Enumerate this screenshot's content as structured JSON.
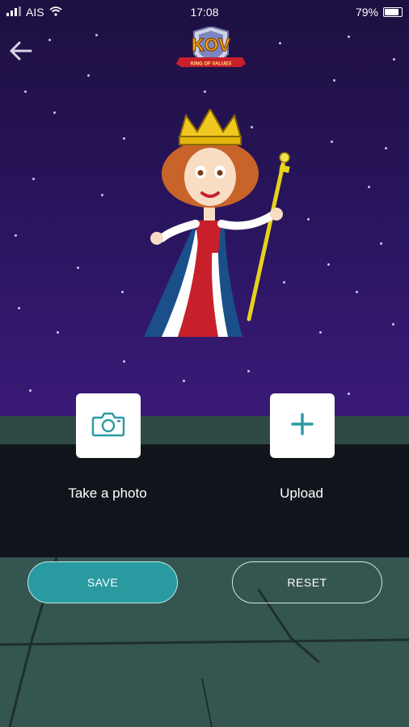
{
  "status_bar": {
    "carrier": "AIS",
    "time": "17:08",
    "battery": "79%"
  },
  "header": {
    "back_icon": "arrow-left-icon",
    "logo_text": "KOV",
    "logo_tagline": "KING OF VALUES"
  },
  "actions": {
    "take_photo": {
      "label": "Take a photo",
      "icon": "camera-icon"
    },
    "upload": {
      "label": "Upload",
      "icon": "plus-icon"
    }
  },
  "buttons": {
    "save_label": "SAVE",
    "reset_label": "RESET"
  },
  "colors": {
    "accent": "#2a9aa1",
    "sky_top": "#1e1040",
    "sky_bottom": "#3a1a78",
    "floor": "#355650"
  }
}
